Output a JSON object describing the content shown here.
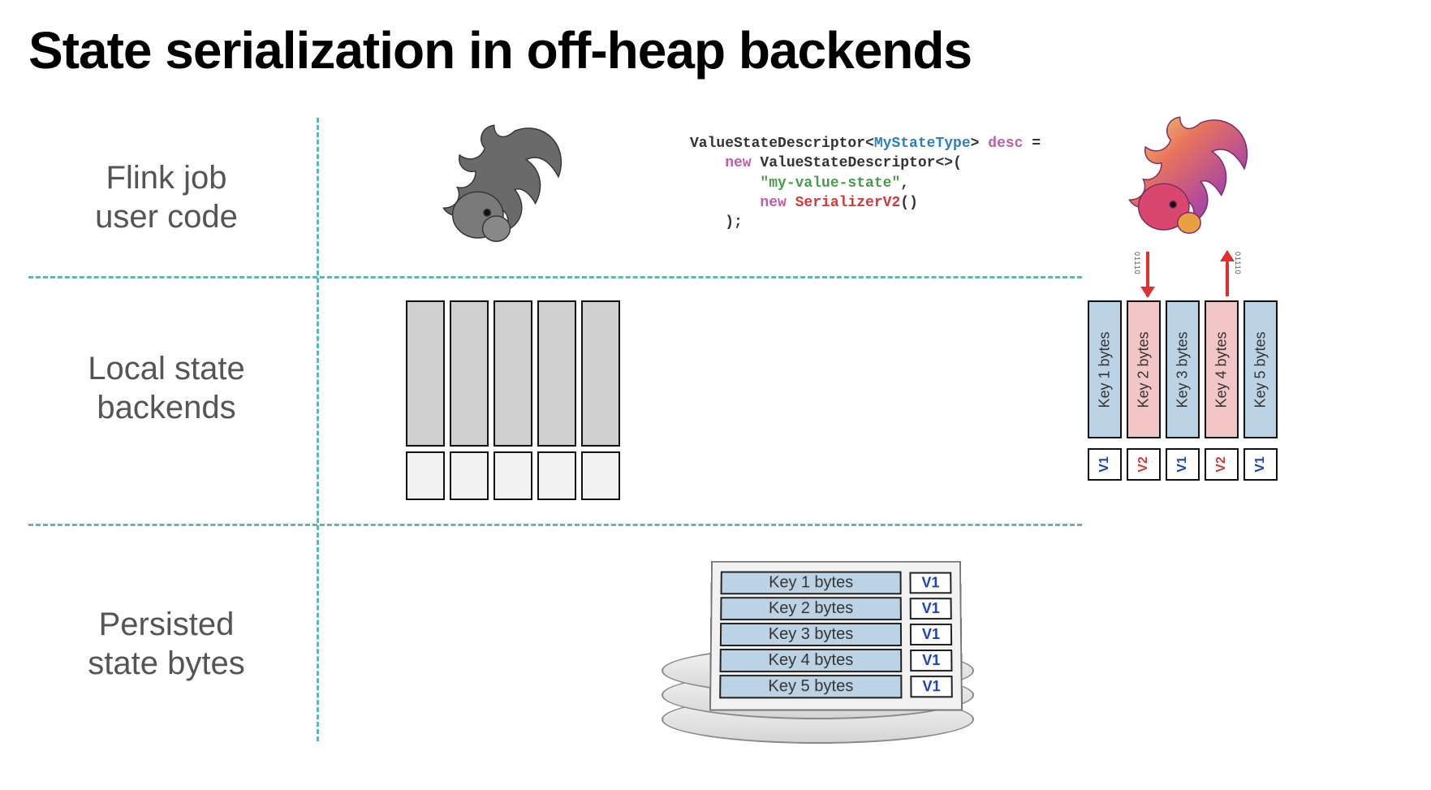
{
  "title": "State serialization in off-heap backends",
  "rows": {
    "r1": "Flink job\nuser code",
    "r2": "Local state\nbackends",
    "r3": "Persisted\nstate bytes"
  },
  "code": {
    "line1a": "ValueStateDescriptor<",
    "line1b": "MyStateType",
    "line1c": "> ",
    "line1d": "desc",
    "line1e": " =",
    "line2a": "    new",
    "line2b": " ValueStateDescriptor<>(",
    "line3": "        \"my-value-state\"",
    "line3b": ",",
    "line4a": "        new",
    "line4b": " SerializerV2",
    "line4c": "()",
    "line5": "    );"
  },
  "arrow_bits": "01110",
  "local_bytes": [
    {
      "label": "Key 1 bytes",
      "tag": "V1",
      "color": "blue"
    },
    {
      "label": "Key 2 bytes",
      "tag": "V2",
      "color": "pink"
    },
    {
      "label": "Key 3 bytes",
      "tag": "V1",
      "color": "blue"
    },
    {
      "label": "Key 4 bytes",
      "tag": "V2",
      "color": "pink"
    },
    {
      "label": "Key 5 bytes",
      "tag": "V1",
      "color": "blue"
    }
  ],
  "persisted": [
    {
      "key": "Key 1 bytes",
      "ver": "V1"
    },
    {
      "key": "Key 2 bytes",
      "ver": "V1"
    },
    {
      "key": "Key 3 bytes",
      "ver": "V1"
    },
    {
      "key": "Key 4 bytes",
      "ver": "V1"
    },
    {
      "key": "Key 5 bytes",
      "ver": "V1"
    }
  ]
}
